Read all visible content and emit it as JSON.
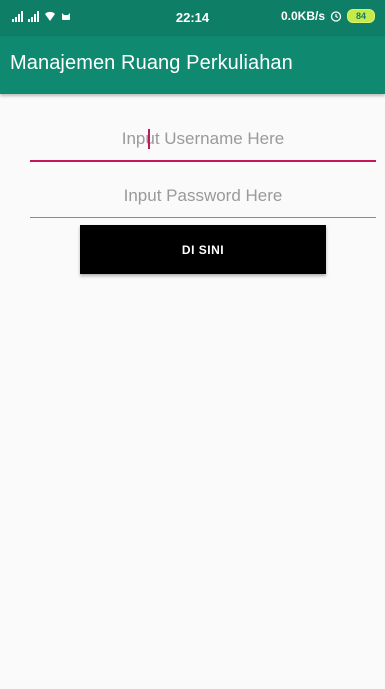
{
  "status_bar": {
    "time": "22:14",
    "network_speed": "0.0KB/s",
    "battery_level": "84",
    "icons": [
      "signal-icon",
      "signal-icon",
      "wifi-icon",
      "notification-icon",
      "alarm-icon",
      "battery-icon"
    ]
  },
  "app_bar": {
    "title": "Manajemen Ruang Perkuliahan",
    "color": "#0f8a70"
  },
  "form": {
    "username": {
      "value": "",
      "placeholder": "Input Username Here"
    },
    "password": {
      "value": "",
      "placeholder": "Input Password Here"
    },
    "submit_label": "DI SINI"
  },
  "colors": {
    "accent": "#c2185b",
    "primary": "#0f8a70",
    "button": "#000000",
    "background": "#fafafa"
  }
}
